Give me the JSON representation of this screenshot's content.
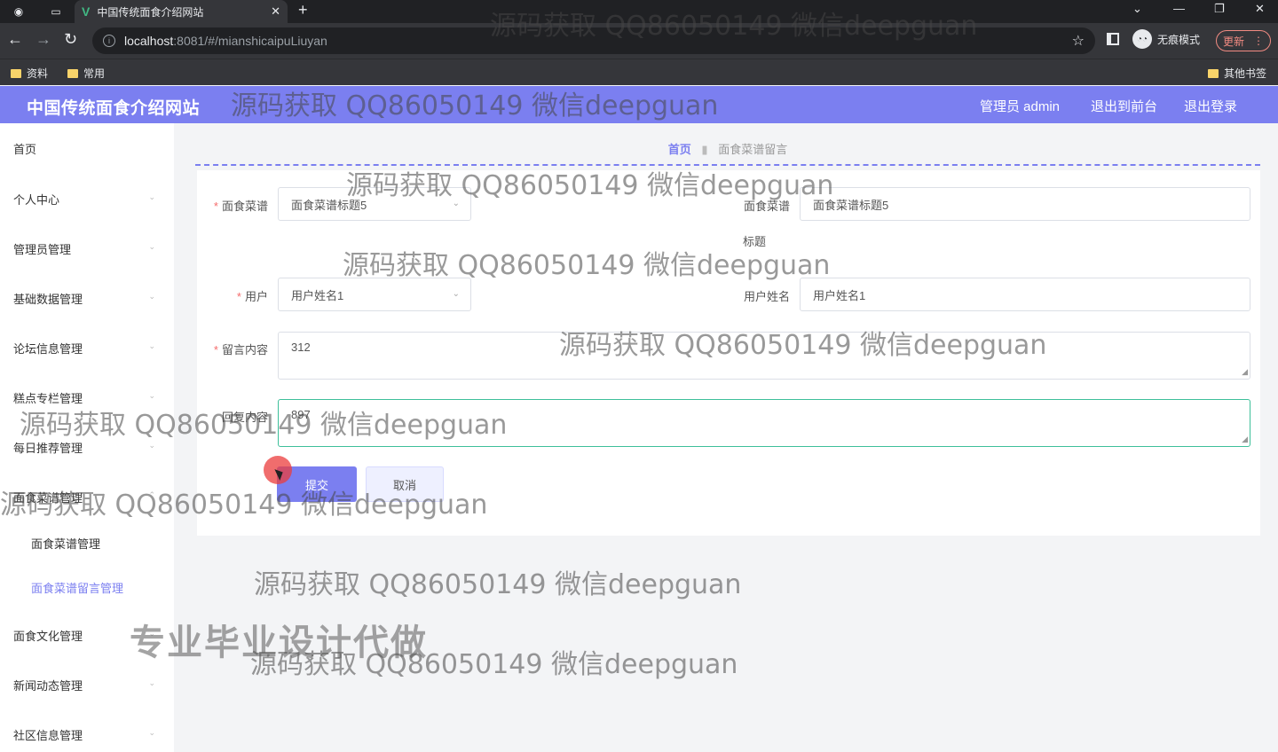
{
  "browser": {
    "tab_title": "中国传统面食介绍网站",
    "url_host": "localhost",
    "url_path": ":8081/#/mianshicaipuLiuyan",
    "incognito_label": "无痕模式",
    "update_label": "更新",
    "bookmarks": [
      "资料",
      "常用"
    ],
    "other_bookmarks": "其他书签"
  },
  "header": {
    "title": "中国传统面食介绍网站",
    "admin": "管理员 admin",
    "exit_front": "退出到前台",
    "logout": "退出登录"
  },
  "sidebar": {
    "items": [
      "首页",
      "个人中心",
      "管理员管理",
      "基础数据管理",
      "论坛信息管理",
      "糕点专栏管理",
      "每日推荐管理",
      "面食菜谱管理",
      "面食文化管理",
      "新闻动态管理",
      "社区信息管理"
    ],
    "sub_items": [
      "面食菜谱管理",
      "面食菜谱留言管理"
    ]
  },
  "breadcrumb": {
    "home": "首页",
    "current": "面食菜谱留言"
  },
  "form": {
    "recipe_label": "面食菜谱",
    "recipe_value": "面食菜谱标题5",
    "recipe_title_label_1": "面食菜谱",
    "recipe_title_label_2": "标题",
    "recipe_title_value": "面食菜谱标题5",
    "user_label": "用户",
    "user_value": "用户姓名1",
    "user_name_label": "用户姓名",
    "user_name_value": "用户姓名1",
    "message_label": "留言内容",
    "message_value": "312",
    "reply_label": "回复内容",
    "reply_value": "897",
    "submit": "提交",
    "cancel": "取消"
  },
  "watermark": {
    "text": "源码获取 QQ86050149 微信deepguan",
    "big": "专业毕业设计代做"
  }
}
